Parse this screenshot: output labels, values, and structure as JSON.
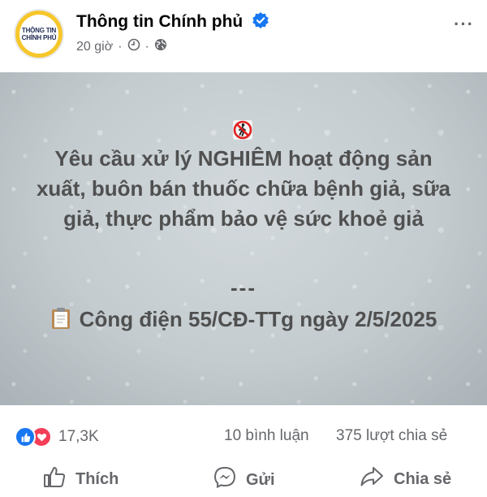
{
  "post": {
    "page_name": "Thông tin Chính phủ",
    "avatar_text": [
      "THÔNG TIN",
      "CHÍNH PHỦ"
    ],
    "time": "20 giờ",
    "separator": "·",
    "more_label": "···",
    "icons": {
      "verified": "verified-badge-icon",
      "clock": "clock-icon",
      "globe": "globe-icon",
      "more": "more-options-icon"
    }
  },
  "image": {
    "headline": "Yêu cầu xử lý NGHIÊM hoạt động sản xuất, buôn bán thuốc chữa bệnh giả, sữa giả, thực phẩm bảo vệ sức khoẻ giả",
    "divider": "---",
    "document": "Công điện 55/CĐ-TTg ngày 2/5/2025",
    "icons": {
      "no_sign": "no-pedestrians-icon",
      "clipboard": "clipboard-icon"
    }
  },
  "stats": {
    "reactions": "17,3K",
    "comments": "10 bình luận",
    "shares": "375 lượt chia sẻ"
  },
  "actions": {
    "like": "Thích",
    "send": "Gửi",
    "share": "Chia sẻ"
  },
  "colors": {
    "like_blue": "#1877f2",
    "love_red": "#f33e58",
    "secondary_text": "#65676b",
    "avatar_yellow": "#f6c62b"
  }
}
